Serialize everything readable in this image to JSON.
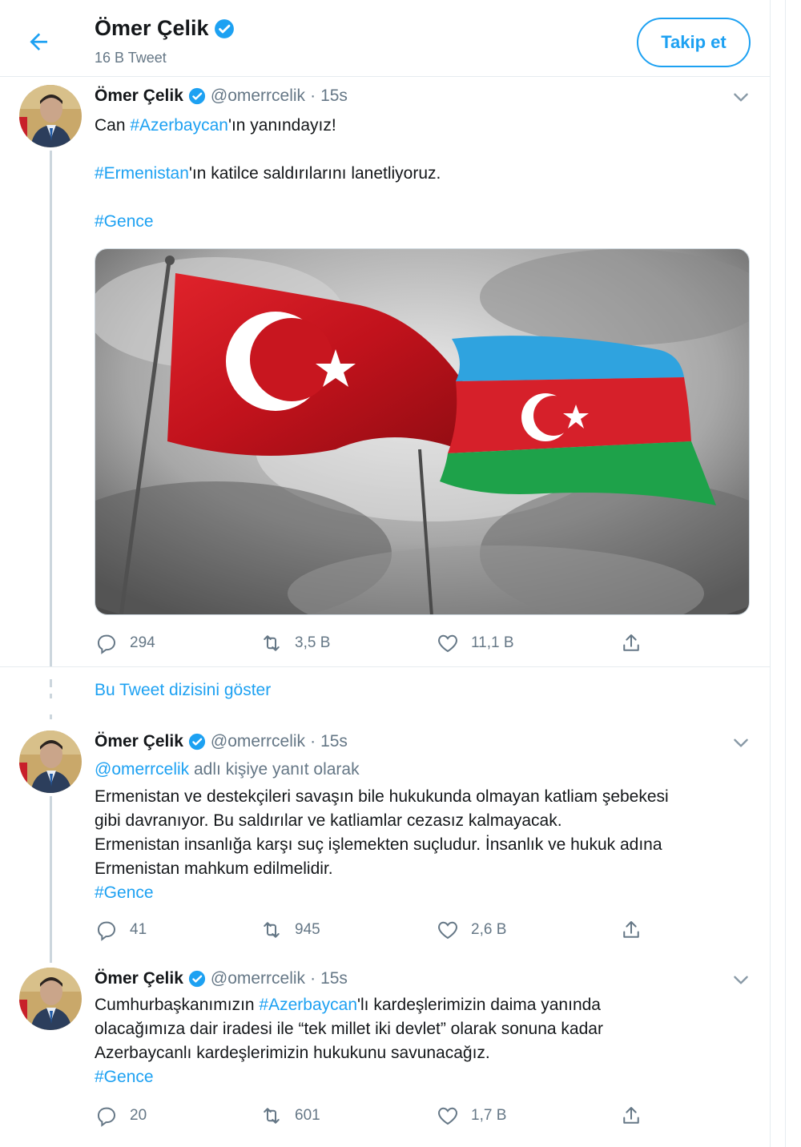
{
  "header": {
    "name": "Ömer Çelik",
    "tweet_count": "16 B Tweet",
    "follow_label": "Takip et"
  },
  "tweets": [
    {
      "name": "Ömer Çelik",
      "handle": "@omerrcelik",
      "sep": "·",
      "time": "15s",
      "line1_pre": "Can ",
      "line1_tag": "#Azerbaycan",
      "line1_post": "'ın yanındayız!",
      "line2_tag": "#Ermenistan",
      "line2_post": "'ın katilce saldırılarını lanetliyoruz.",
      "line3_tag": "#Gence",
      "replies": "294",
      "retweets": "3,5 B",
      "likes": "11,1 B"
    },
    {
      "name": "Ömer Çelik",
      "handle": "@omerrcelik",
      "sep": "·",
      "time": "15s",
      "reply_to_handle": "@omerrcelik",
      "reply_to_text": " adlı kişiye yanıt olarak",
      "body_lines": [
        "Ermenistan ve destekçileri savaşın bile hukukunda olmayan katliam şebekesi",
        "gibi davranıyor. Bu saldırılar ve katliamlar cezasız kalmayacak.",
        "Ermenistan insanlığa karşı suç işlemekten suçludur. İnsanlık ve hukuk adına",
        "Ermenistan mahkum edilmelidir."
      ],
      "tag": "#Gence",
      "replies": "41",
      "retweets": "945",
      "likes": "2,6 B"
    },
    {
      "name": "Ömer Çelik",
      "handle": "@omerrcelik",
      "sep": "·",
      "time": "15s",
      "line1_pre": "Cumhurbaşkanımızın ",
      "line1_tag": "#Azerbaycan",
      "line1_post": "'lı kardeşlerimizin daima yanında",
      "line2": "olacağımıza dair iradesi ile “tek millet iki devlet” olarak sonuna kadar",
      "line3": "Azerbaycanlı kardeşlerimizin hukukunu savunacağız.",
      "tag": "#Gence",
      "replies": "20",
      "retweets": "601",
      "likes": "1,7 B"
    }
  ],
  "show_thread": "Bu Tweet dizisini göster",
  "colors": {
    "accent": "#1da1f2",
    "muted": "#657786"
  },
  "icons": [
    "back-arrow-icon",
    "verified-badge-icon",
    "chevron-down-icon",
    "reply-icon",
    "retweet-icon",
    "like-icon",
    "share-icon"
  ]
}
